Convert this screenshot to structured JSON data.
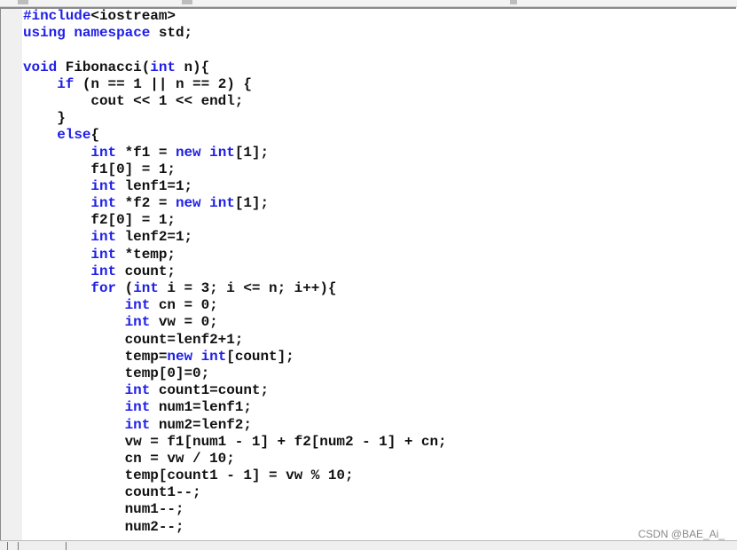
{
  "editor": {
    "lines": [
      [
        [
          "#include",
          "kw"
        ],
        [
          "<iostream>",
          ""
        ]
      ],
      [
        [
          "using",
          "kw"
        ],
        [
          " ",
          ""
        ],
        [
          "namespace",
          "kw"
        ],
        [
          " std;",
          ""
        ]
      ],
      [],
      [
        [
          "void",
          "kw"
        ],
        [
          " Fibonacci(",
          ""
        ],
        [
          "int",
          "kw"
        ],
        [
          " n){",
          ""
        ]
      ],
      [
        [
          "    ",
          ""
        ],
        [
          "if",
          "kw"
        ],
        [
          " (n == 1 || n == 2) {",
          ""
        ]
      ],
      [
        [
          "        cout << 1 << endl;",
          ""
        ]
      ],
      [
        [
          "    }",
          ""
        ]
      ],
      [
        [
          "    ",
          ""
        ],
        [
          "else",
          "kw"
        ],
        [
          "{",
          ""
        ]
      ],
      [
        [
          "        ",
          ""
        ],
        [
          "int",
          "kw"
        ],
        [
          " *f1 = ",
          ""
        ],
        [
          "new",
          "kw"
        ],
        [
          " ",
          ""
        ],
        [
          "int",
          "kw"
        ],
        [
          "[1];",
          ""
        ]
      ],
      [
        [
          "        f1[0] = 1;",
          ""
        ]
      ],
      [
        [
          "        ",
          ""
        ],
        [
          "int",
          "kw"
        ],
        [
          " lenf1=1;",
          ""
        ]
      ],
      [
        [
          "        ",
          ""
        ],
        [
          "int",
          "kw"
        ],
        [
          " *f2 = ",
          ""
        ],
        [
          "new",
          "kw"
        ],
        [
          " ",
          ""
        ],
        [
          "int",
          "kw"
        ],
        [
          "[1];",
          ""
        ]
      ],
      [
        [
          "        f2[0] = 1;",
          ""
        ]
      ],
      [
        [
          "        ",
          ""
        ],
        [
          "int",
          "kw"
        ],
        [
          " lenf2=1;",
          ""
        ]
      ],
      [
        [
          "        ",
          ""
        ],
        [
          "int",
          "kw"
        ],
        [
          " *temp;",
          ""
        ]
      ],
      [
        [
          "        ",
          ""
        ],
        [
          "int",
          "kw"
        ],
        [
          " count;",
          ""
        ]
      ],
      [
        [
          "        ",
          ""
        ],
        [
          "for",
          "kw"
        ],
        [
          " (",
          ""
        ],
        [
          "int",
          "kw"
        ],
        [
          " i = 3; i <= n; i++){",
          ""
        ]
      ],
      [
        [
          "            ",
          ""
        ],
        [
          "int",
          "kw"
        ],
        [
          " cn = 0;",
          ""
        ]
      ],
      [
        [
          "            ",
          ""
        ],
        [
          "int",
          "kw"
        ],
        [
          " vw = 0;",
          ""
        ]
      ],
      [
        [
          "            count=lenf2+1;",
          ""
        ]
      ],
      [
        [
          "            temp=",
          ""
        ],
        [
          "new",
          "kw"
        ],
        [
          " ",
          ""
        ],
        [
          "int",
          "kw"
        ],
        [
          "[count];",
          ""
        ]
      ],
      [
        [
          "            temp[0]=0;",
          ""
        ]
      ],
      [
        [
          "            ",
          ""
        ],
        [
          "int",
          "kw"
        ],
        [
          " count1=count;",
          ""
        ]
      ],
      [
        [
          "            ",
          ""
        ],
        [
          "int",
          "kw"
        ],
        [
          " num1=lenf1;",
          ""
        ]
      ],
      [
        [
          "            ",
          ""
        ],
        [
          "int",
          "kw"
        ],
        [
          " num2=lenf2;",
          ""
        ]
      ],
      [
        [
          "            vw = f1[num1 - 1] + f2[num2 - 1] + cn;",
          ""
        ]
      ],
      [
        [
          "            cn = vw / 10;",
          ""
        ]
      ],
      [
        [
          "            temp[count1 - 1] = vw % 10;",
          ""
        ]
      ],
      [
        [
          "            count1--;",
          ""
        ]
      ],
      [
        [
          "            num1--;",
          ""
        ]
      ],
      [
        [
          "            num2--;",
          ""
        ]
      ]
    ]
  },
  "watermark": "CSDN @BAE_Ai_",
  "colors": {
    "keyword": "#1f1fe8",
    "text": "#111111",
    "gutter": "#f0f0f0"
  }
}
